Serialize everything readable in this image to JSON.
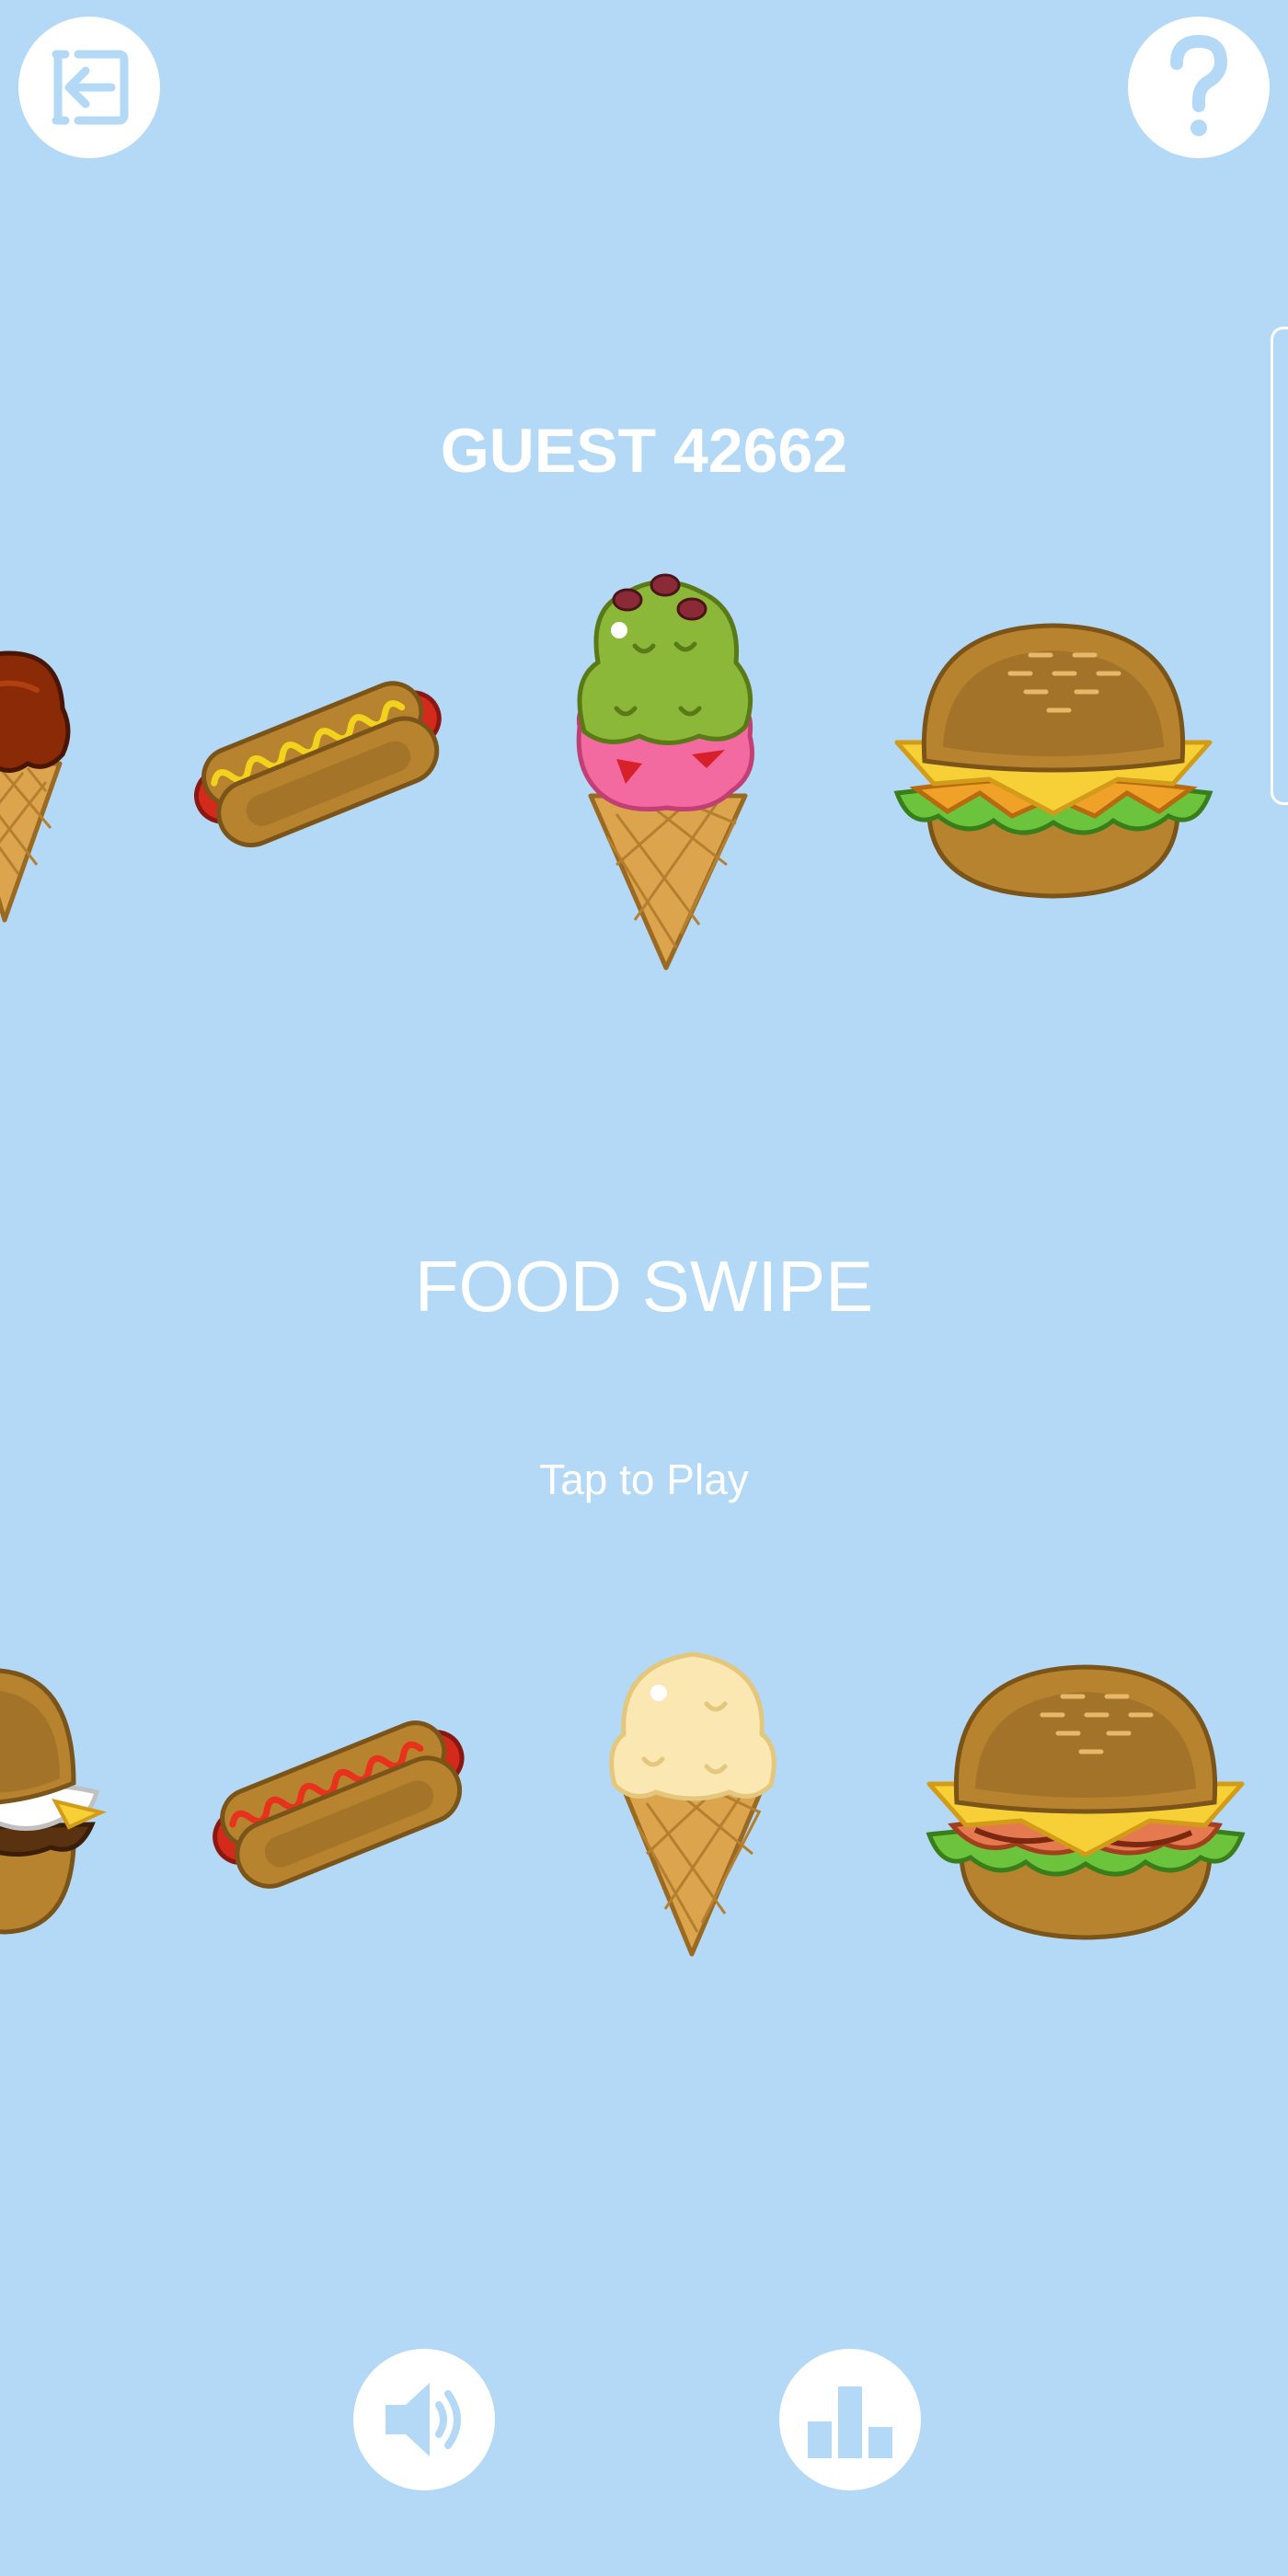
{
  "colors": {
    "background": "#b3d9f7",
    "button_fill": "#ffffff",
    "icon_color": "#b3d9f7",
    "text": "#ffffff"
  },
  "header": {
    "exit_icon": "exit-arrow-icon",
    "help_icon": "question-mark-icon"
  },
  "player": {
    "name": "GUEST 42662"
  },
  "title": {
    "text": "FOOD SWIPE",
    "prompt": "Tap to Play"
  },
  "food_rows": [
    {
      "items": [
        "chocolate-ice-cream-cone",
        "mustard-hot-dog",
        "green-pink-ice-cream-cone",
        "cheeseburger"
      ]
    },
    {
      "items": [
        "cream-burger",
        "ketchup-hot-dog",
        "vanilla-ice-cream-cone",
        "bacon-cheeseburger"
      ]
    }
  ],
  "footer": {
    "sound_icon": "speaker-icon",
    "leaderboard_icon": "podium-icon"
  }
}
